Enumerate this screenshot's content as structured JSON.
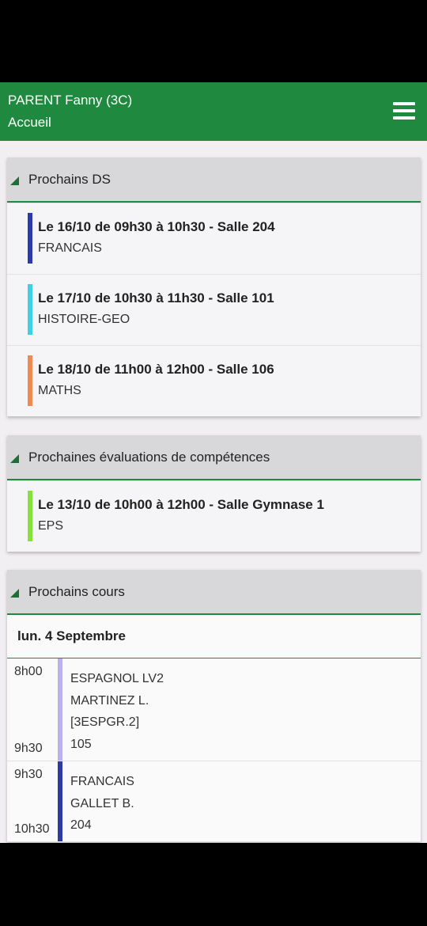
{
  "header": {
    "name": "PARENT Fanny (3C)",
    "page": "Accueil"
  },
  "ds": {
    "title": "Prochains DS",
    "items": [
      {
        "line": "Le 16/10 de 09h30 à 10h30 - Salle 204",
        "subject": "FRANCAIS",
        "color": "#2a3aa8"
      },
      {
        "line": "Le 17/10 de 10h30 à 11h30 - Salle 101",
        "subject": "HISTOIRE-GEO",
        "color": "#3fd0e8"
      },
      {
        "line": "Le 18/10 de 11h00 à 12h00 - Salle 106",
        "subject": "MATHS",
        "color": "#ee8a52"
      }
    ]
  },
  "evals": {
    "title": "Prochaines évaluations de compétences",
    "items": [
      {
        "line": "Le 13/10 de 10h00 à 12h00 - Salle Gymnase 1",
        "subject": "EPS",
        "color": "#86e23c"
      }
    ]
  },
  "courses": {
    "title": "Prochains cours",
    "day": "lun. 4 Septembre",
    "lessons": [
      {
        "start": "8h00",
        "end": "9h30",
        "subject": "ESPAGNOL LV2",
        "teacher": "MARTINEZ L.",
        "group": "[3ESPGR.2]",
        "room": "105",
        "color": "#b9b2ec"
      },
      {
        "start": "9h30",
        "end": "10h30",
        "subject": "FRANCAIS",
        "teacher": "GALLET B.",
        "group": "",
        "room": "204",
        "color": "#2a3aa8"
      }
    ]
  }
}
